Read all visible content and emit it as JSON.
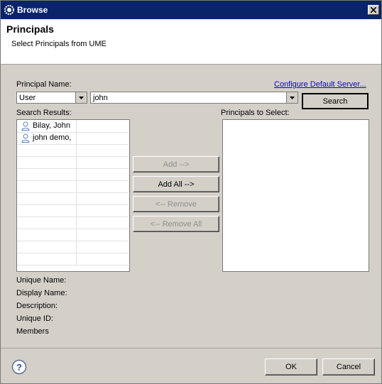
{
  "window": {
    "title": "Browse"
  },
  "banner": {
    "title": "Principals",
    "subtitle": "Select Principals from UME"
  },
  "form": {
    "principal_name_label": "Principal Name:",
    "configure_link": "Configure Default Server...",
    "type_value": "User",
    "search_value": "john",
    "search_button": "Search",
    "search_results_label": "Search Results:",
    "principals_to_select_label": "Principals to Select:"
  },
  "results": [
    {
      "name": "Bilay, John",
      "icon": "user-icon"
    },
    {
      "name": "john demo,",
      "icon": "user-icon"
    }
  ],
  "buttons": {
    "add": "Add -->",
    "add_all": "Add All -->",
    "remove": "<-- Remove",
    "remove_all": "<-- Remove All",
    "ok": "OK",
    "cancel": "Cancel"
  },
  "details": {
    "unique_name": "Unique Name:",
    "display_name": "Display Name:",
    "description": "Description:",
    "unique_id": "Unique ID:",
    "members": "Members"
  },
  "icons": {
    "title": "gear-icon",
    "close": "close-icon",
    "help": "help-icon"
  },
  "colors": {
    "titlebar": "#0a246a",
    "link": "#0a0ab0",
    "user_icon": "#5b84c4"
  }
}
